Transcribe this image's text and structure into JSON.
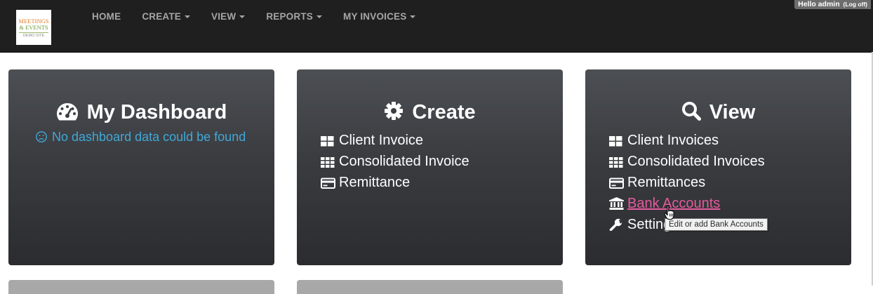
{
  "logo": {
    "line1": "MEETINGS",
    "line2": "& EVENTS",
    "line3": "DEMO SITE"
  },
  "nav": {
    "items": [
      {
        "label": "HOME",
        "dropdown": false
      },
      {
        "label": "CREATE",
        "dropdown": true
      },
      {
        "label": "VIEW",
        "dropdown": true
      },
      {
        "label": "REPORTS",
        "dropdown": true
      },
      {
        "label": "MY INVOICES",
        "dropdown": true
      }
    ]
  },
  "user": {
    "greeting": "Hello admin",
    "logoff": "(Log off)"
  },
  "dashboard": {
    "title": "My Dashboard",
    "icon": "tachometer-icon",
    "empty_icon": "frown-icon",
    "empty_message": "No dashboard data could be found"
  },
  "create": {
    "title": "Create",
    "icon": "gear-icon",
    "items": [
      {
        "label": "Client Invoice",
        "icon": "grid-large-icon"
      },
      {
        "label": "Consolidated Invoice",
        "icon": "grid-small-icon"
      },
      {
        "label": "Remittance",
        "icon": "credit-card-icon"
      }
    ]
  },
  "view": {
    "title": "View",
    "icon": "search-icon",
    "items": [
      {
        "label": "Client Invoices",
        "icon": "grid-large-icon"
      },
      {
        "label": "Consolidated Invoices",
        "icon": "grid-small-icon"
      },
      {
        "label": "Remittances",
        "icon": "credit-card-icon"
      },
      {
        "label": "Bank Accounts",
        "icon": "bank-icon",
        "hovered": true
      },
      {
        "label": "Settings",
        "icon": "wrench-icon"
      }
    ]
  },
  "tooltip": {
    "text": "Edit or add Bank Accounts"
  },
  "colors": {
    "navbar": "#1f1f1f",
    "nav_text": "#a6a6a6",
    "panel_top": "#4c4f54",
    "panel_bottom": "#2b2c2f",
    "info_text": "#41a8d6",
    "link_hover": "#e55a9d"
  }
}
